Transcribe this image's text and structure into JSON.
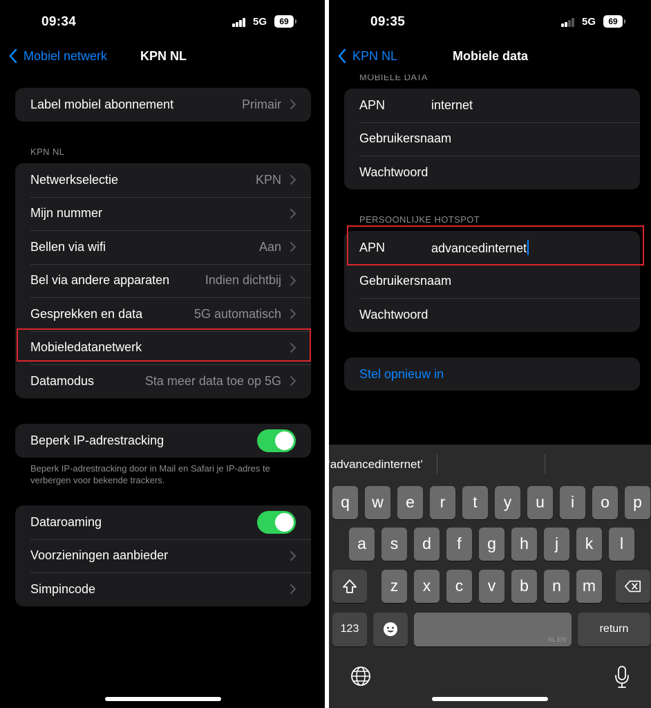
{
  "left": {
    "status": {
      "time": "09:34",
      "network": "5G",
      "battery": "69"
    },
    "nav": {
      "back_label": "Mobiel netwerk",
      "title": "KPN NL"
    },
    "group1": [
      {
        "label": "Label mobiel abonnement",
        "value": "Primair"
      }
    ],
    "section_header": "KPN NL",
    "group2": [
      {
        "label": "Netwerkselectie",
        "value": "KPN"
      },
      {
        "label": "Mijn nummer",
        "value": ""
      },
      {
        "label": "Bellen via wifi",
        "value": "Aan"
      },
      {
        "label": "Bel via andere apparaten",
        "value": "Indien dichtbij"
      },
      {
        "label": "Gesprekken en data",
        "value": "5G automatisch"
      },
      {
        "label": "Mobieledatanetwerk",
        "value": ""
      },
      {
        "label": "Datamodus",
        "value": "Sta meer data toe op 5G"
      }
    ],
    "group3": {
      "label": "Beperk IP-adrestracking",
      "on": true
    },
    "footnote": "Beperk IP-adrestracking door in Mail en Safari je IP-adres te verbergen voor bekende trackers.",
    "group4": [
      {
        "label": "Dataroaming",
        "toggle": true
      },
      {
        "label": "Voorzieningen aanbieder",
        "value": ""
      },
      {
        "label": "Simpincode",
        "value": ""
      }
    ],
    "highlight_color": "#d9252a"
  },
  "right": {
    "status": {
      "time": "09:35",
      "network": "5G",
      "battery": "69"
    },
    "nav": {
      "back_label": "KPN NL",
      "title": "Mobiele data"
    },
    "section1": "MOBIELE DATA",
    "mobile_data": [
      {
        "label": "APN",
        "value": "internet"
      },
      {
        "label": "Gebruikersnaam",
        "value": ""
      },
      {
        "label": "Wachtwoord",
        "value": ""
      }
    ],
    "section2": "PERSOONLIJKE HOTSPOT",
    "hotspot": [
      {
        "label": "APN",
        "value": "advancedinternet"
      },
      {
        "label": "Gebruikersnaam",
        "value": ""
      },
      {
        "label": "Wachtwoord",
        "value": ""
      }
    ],
    "reset_label": "Stel opnieuw in",
    "keyboard": {
      "suggestion": "‘advancedinternet’",
      "row1": [
        "q",
        "w",
        "e",
        "r",
        "t",
        "y",
        "u",
        "i",
        "o",
        "p"
      ],
      "row2": [
        "a",
        "s",
        "d",
        "f",
        "g",
        "h",
        "j",
        "k",
        "l"
      ],
      "row3": [
        "z",
        "x",
        "c",
        "v",
        "b",
        "n",
        "m"
      ],
      "numbers_label": "123",
      "return_label": "return",
      "space_lang": "NL EN"
    }
  },
  "colors": {
    "accent": "#0a84ff",
    "toggle_on": "#30d158",
    "cell_bg": "#1c1c1e"
  }
}
